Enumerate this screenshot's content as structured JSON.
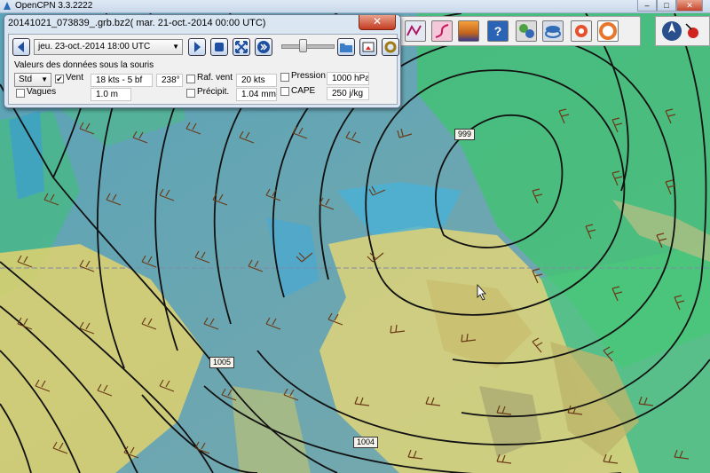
{
  "app": {
    "title": "OpenCPN 3.3.2222"
  },
  "window_controls": {
    "minimize": "–",
    "maximize": "□",
    "close": "✕"
  },
  "grib": {
    "title": "20141021_073839_.grb.bz2( mar. 21-oct.-2014 00:00  UTC)",
    "close": "✕",
    "time_select": "jeu. 23-oct.-2014 18:00  UTC",
    "section_label": "Valeurs des données sous la souris",
    "mode_select": "Std",
    "wind": {
      "label": "Vent",
      "checked": true,
      "speed": "18 kts - 5 bf",
      "direction": "238°"
    },
    "gust": {
      "label": "Raf. vent",
      "checked": false,
      "value": "20 kts"
    },
    "pressure": {
      "label": "Pression",
      "checked": false,
      "value": "1000 hPa"
    },
    "waves": {
      "label": "Vagues",
      "checked": false,
      "value": "1.0 m"
    },
    "precip": {
      "label": "Précipit.",
      "checked": false,
      "value": "1.04 mm"
    },
    "cape": {
      "label": "CAPE",
      "checked": false,
      "value": "250 j/kg"
    }
  },
  "map_labels": {
    "isobar_999": "999",
    "isobar_1005": "1005",
    "isobar_1004": "1004"
  },
  "toolbar": {
    "icons": [
      "grib-chart-icon",
      "route-icon",
      "tides-icon",
      "help-icon",
      "settings-icon",
      "layers-icon",
      "man-overboard-icon",
      "lifebuoy-icon"
    ]
  },
  "colors": {
    "sea": "#6f9fb0",
    "land": "#d8d27a",
    "wind_green": "#3cc46a",
    "isobar": "#111111",
    "arrow": "#6b3a16"
  }
}
